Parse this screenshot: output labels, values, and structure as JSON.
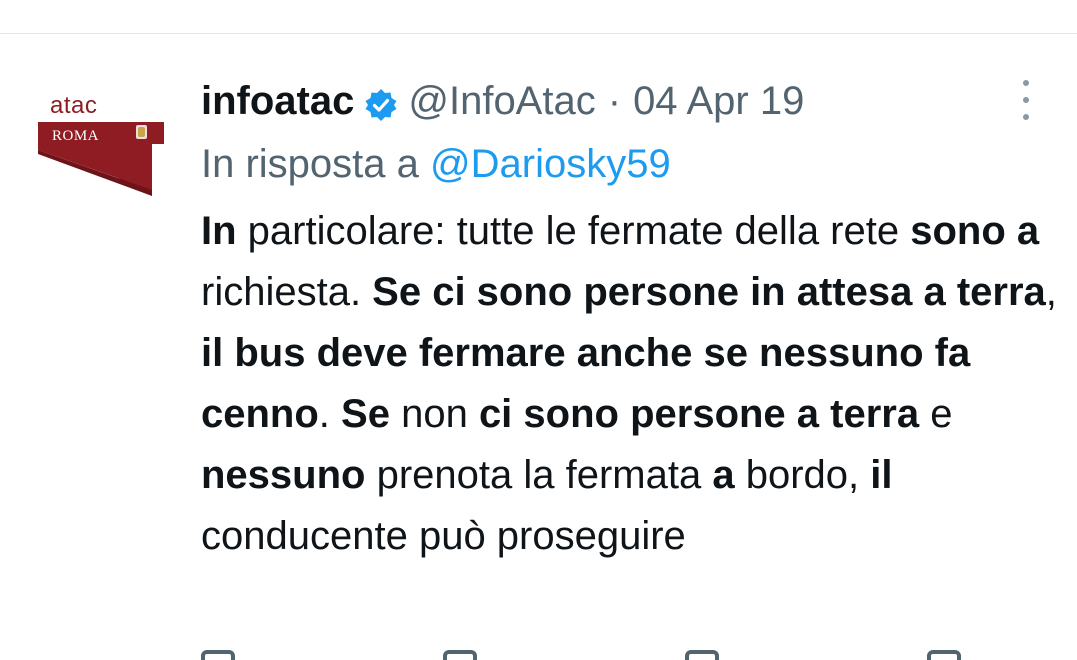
{
  "account": {
    "avatar_brand": "atac",
    "avatar_city": "ROMA",
    "display_name": "infoatac",
    "handle": "@InfoAtac",
    "separator": "·",
    "date": "04 Apr 19",
    "verified": true
  },
  "reply": {
    "prefix": "In risposta a",
    "to_handle": "@Dariosky59"
  },
  "tweet": {
    "segments": [
      {
        "text": "In",
        "bold": true
      },
      {
        "text": " particolare: tutte le fermate della rete ",
        "bold": false
      },
      {
        "text": "sono a",
        "bold": true
      },
      {
        "text": " richiesta. ",
        "bold": false
      },
      {
        "text": "Se ci sono persone in attesa a terra",
        "bold": true
      },
      {
        "text": ", ",
        "bold": false
      },
      {
        "text": "il bus deve fermare anche se nessuno fa cenno",
        "bold": true
      },
      {
        "text": ". ",
        "bold": false
      },
      {
        "text": "Se",
        "bold": true
      },
      {
        "text": " non ",
        "bold": false
      },
      {
        "text": "ci sono persone a terra",
        "bold": true
      },
      {
        "text": " e ",
        "bold": false
      },
      {
        "text": "nessuno",
        "bold": true
      },
      {
        "text": " prenota la fermata ",
        "bold": false
      },
      {
        "text": "a",
        "bold": true
      },
      {
        "text": " bordo, ",
        "bold": false
      },
      {
        "text": "il",
        "bold": true
      },
      {
        "text": " conducente può proseguire",
        "bold": false
      }
    ]
  },
  "colors": {
    "text": "#0f1419",
    "secondary": "#536471",
    "link": "#1d9bf0",
    "brand": "#8e1c22"
  },
  "icons": {
    "verified": "verified-badge-icon",
    "more": "more-vertical-icon"
  }
}
